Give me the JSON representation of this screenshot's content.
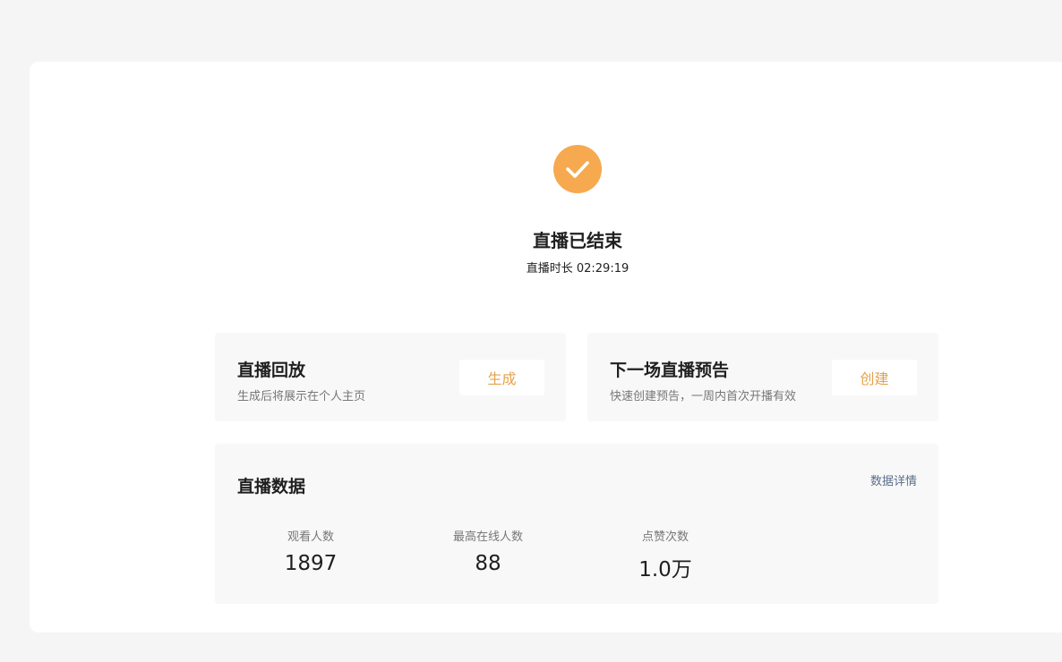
{
  "status": {
    "icon": "check-circle-icon",
    "title": "直播已结束",
    "duration_text": "直播时长 02:29:19"
  },
  "replay": {
    "title": "直播回放",
    "subtitle": "生成后将展示在个人主页",
    "button_label": "生成"
  },
  "preview": {
    "title": "下一场直播预告",
    "subtitle": "快速创建预告，一周内首次开播有效",
    "button_label": "创建"
  },
  "stats": {
    "title": "直播数据",
    "detail_link": "数据详情",
    "metrics": [
      {
        "label": "观看人数",
        "value": "1897"
      },
      {
        "label": "最高在线人数",
        "value": "88"
      },
      {
        "label": "点赞次数",
        "value": "1.0万"
      }
    ]
  },
  "colors": {
    "accent": "#f6a94f",
    "button_text": "#e4a24c",
    "link": "#5a6e8a",
    "page_bg": "#f5f5f5",
    "panel_bg": "#f8f8f8"
  }
}
